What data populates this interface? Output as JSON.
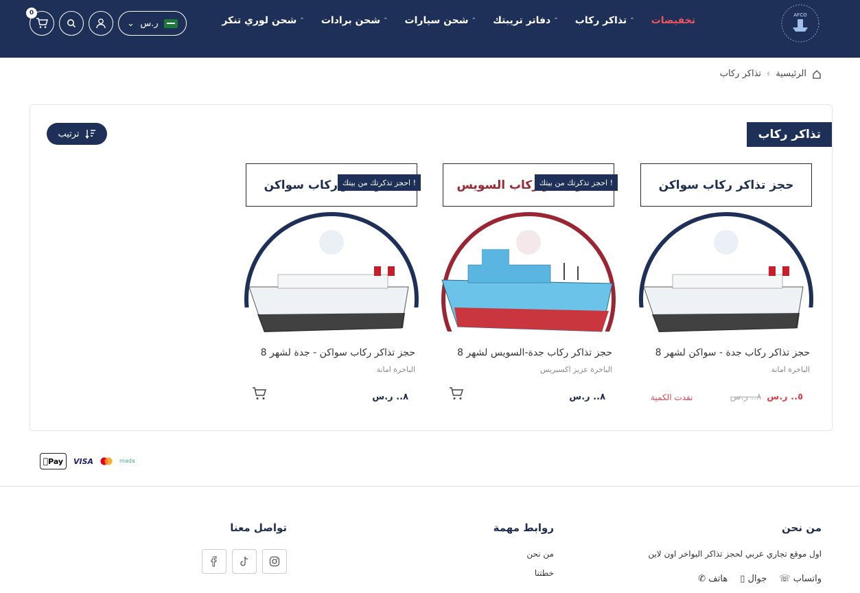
{
  "header": {
    "nav": [
      {
        "label": "تخفيضات",
        "highlight": true
      },
      {
        "label": "تذاكر ركاب"
      },
      {
        "label": "دفاتر تريبتك"
      },
      {
        "label": "شحن سيارات"
      },
      {
        "label": "شحن برادات"
      },
      {
        "label": "شحن لوري تنكر"
      }
    ],
    "currency": "ر.س",
    "cart_count": "0"
  },
  "breadcrumb": {
    "home": "الرئيسية",
    "current": "تذاكر ركاب"
  },
  "panel": {
    "title": "تذاكر ركاب",
    "sort_label": "ترتيب"
  },
  "products": [
    {
      "banner": "حجز تذاكر ركاب سواكن",
      "name": "حجز تذاكر ركاب جدة - سواكن لشهر 8",
      "ship": "الباخرة امانة",
      "price": "٥.. ر.س",
      "old_price": "٨.. ر.س",
      "status": "نفدت الكمية",
      "ring_color": "#1f3058"
    },
    {
      "banner": "حجز تذاكر ركاب السويس",
      "tag": "احجز تذكرتك من بيتك !",
      "name": "حجز تذاكر ركاب جدة-السويس لشهر 8",
      "ship": "الباخرة عزيز اكسبريس",
      "price": "٨.. ر.س",
      "ring_color": "#9a2634"
    },
    {
      "banner": "حجز تذاكر ركاب سواكن",
      "tag": "احجز تذكرتك من بيتك !",
      "name": "حجز تذاكر ركاب سواكن - جدة لشهر 8",
      "ship": "الباخرة امانة",
      "price": "٨.. ر.س",
      "ring_color": "#1f3058"
    }
  ],
  "payments": [
    "Pay",
    "VISA",
    "mada"
  ],
  "footer": {
    "about": {
      "title": "من نحن",
      "text": "اول موقع تجاري عربي لحجز تذاكر البواخر اون لاين",
      "contacts": [
        "واتساب",
        "جوال",
        "هاتف"
      ]
    },
    "links": {
      "title": "روابط مهمة",
      "items": [
        "من نحن",
        "خطتنا"
      ]
    },
    "contact": {
      "title": "تواصل معنا"
    }
  }
}
